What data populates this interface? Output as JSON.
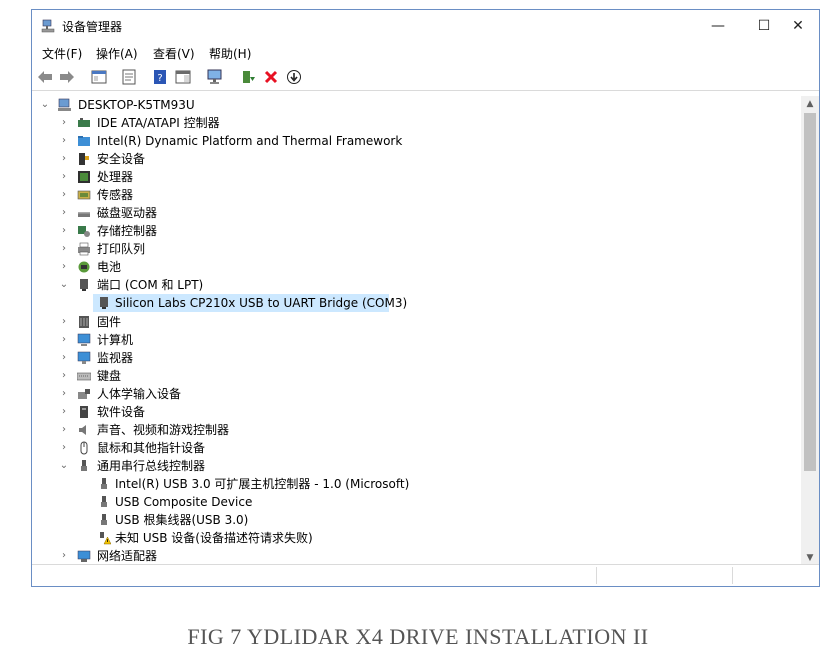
{
  "window": {
    "title": "设备管理器",
    "buttons": {
      "minimize": "—",
      "maximize": "☐",
      "close": "✕"
    }
  },
  "menu": [
    "文件(F)",
    "操作(A)",
    "查看(V)",
    "帮助(H)"
  ],
  "tree": {
    "root": "DESKTOP-K5TM93U",
    "items": [
      {
        "label": "IDE ATA/ATAPI 控制器",
        "icon": "ide-controller-icon",
        "expanded": false
      },
      {
        "label": "Intel(R) Dynamic Platform and Thermal Framework",
        "icon": "folder-icon",
        "expanded": false
      },
      {
        "label": "安全设备",
        "icon": "security-icon",
        "expanded": false
      },
      {
        "label": "处理器",
        "icon": "processor-icon",
        "expanded": false
      },
      {
        "label": "传感器",
        "icon": "sensor-icon",
        "expanded": false
      },
      {
        "label": "磁盘驱动器",
        "icon": "disk-icon",
        "expanded": false
      },
      {
        "label": "存储控制器",
        "icon": "storage-icon",
        "expanded": false
      },
      {
        "label": "打印队列",
        "icon": "printer-icon",
        "expanded": false
      },
      {
        "label": "电池",
        "icon": "battery-icon",
        "expanded": false
      },
      {
        "label": "端口 (COM 和 LPT)",
        "icon": "port-icon",
        "expanded": true,
        "children": [
          {
            "label": "Silicon Labs CP210x USB to UART Bridge (COM3)",
            "icon": "port-icon",
            "selected": true
          }
        ]
      },
      {
        "label": "固件",
        "icon": "firmware-icon",
        "expanded": false
      },
      {
        "label": "计算机",
        "icon": "computer-icon",
        "expanded": false
      },
      {
        "label": "监视器",
        "icon": "monitor-icon",
        "expanded": false
      },
      {
        "label": "键盘",
        "icon": "keyboard-icon",
        "expanded": false
      },
      {
        "label": "人体学输入设备",
        "icon": "hid-icon",
        "expanded": false
      },
      {
        "label": "软件设备",
        "icon": "software-device-icon",
        "expanded": false
      },
      {
        "label": "声音、视频和游戏控制器",
        "icon": "audio-icon",
        "expanded": false
      },
      {
        "label": "鼠标和其他指针设备",
        "icon": "mouse-icon",
        "expanded": false
      },
      {
        "label": "通用串行总线控制器",
        "icon": "usb-icon",
        "expanded": true,
        "children": [
          {
            "label": "Intel(R) USB 3.0 可扩展主机控制器 - 1.0 (Microsoft)",
            "icon": "usb-icon"
          },
          {
            "label": "USB Composite Device",
            "icon": "usb-icon"
          },
          {
            "label": "USB 根集线器(USB 3.0)",
            "icon": "usb-icon"
          },
          {
            "label": "未知 USB 设备(设备描述符请求失败)",
            "icon": "usb-warning-icon"
          }
        ]
      },
      {
        "label": "网络适配器",
        "icon": "network-icon",
        "expanded": false
      }
    ]
  },
  "caption": "FIG 7 YDLIDAR X4 DRIVE INSTALLATION II",
  "colors": {
    "selection": "#cce8ff",
    "frame": "#6a8ec4",
    "close_x": "#e81123"
  }
}
